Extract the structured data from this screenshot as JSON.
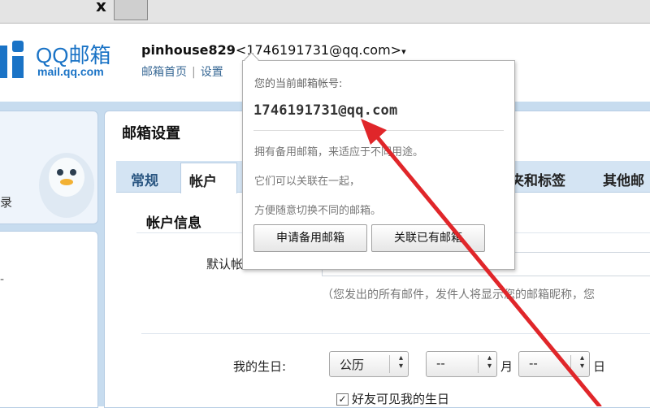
{
  "browser": {
    "close_glyph": "x"
  },
  "brand": {
    "name": "QQ邮箱",
    "url": "mail.qq.com"
  },
  "user": {
    "nickname": "pinhouse829",
    "email_display": "<1746191731@qq.com>",
    "dropdown_glyph": "▾"
  },
  "nav": {
    "home": "邮箱首页",
    "separator": "|",
    "settings": "设置"
  },
  "sidebar": {
    "label": "录",
    "dash": "-"
  },
  "page": {
    "title": "邮箱设置"
  },
  "tabs": [
    {
      "label": "常规"
    },
    {
      "label": "帐户"
    },
    {
      "label": "夹和标签"
    },
    {
      "label": "其他邮"
    }
  ],
  "account": {
    "section_title": "帐户信息",
    "default_label": "默认帐",
    "hint": "（您发出的所有邮件，发件人将显示您的邮箱昵称，您"
  },
  "birthday": {
    "label": "我的生日:",
    "calendar_value": "公历",
    "month_value": "--",
    "month_unit": "月",
    "day_value": "--",
    "day_unit": "日",
    "visible_checked": true,
    "visible_label": "好友可见我的生日"
  },
  "popover": {
    "label": "您的当前邮箱帐号:",
    "email": "1746191731@qq.com",
    "line1": "拥有备用邮箱，来适应于不同用途。",
    "line2": "它们可以关联在一起，",
    "line3": "方便随意切换不同的邮箱。",
    "apply_button": "申请备用邮箱",
    "link_button": "关联已有邮箱"
  },
  "colors": {
    "brand_blue": "#1a73c6",
    "annotation_red": "#e0262a",
    "panel_blue": "#c7dcef"
  }
}
